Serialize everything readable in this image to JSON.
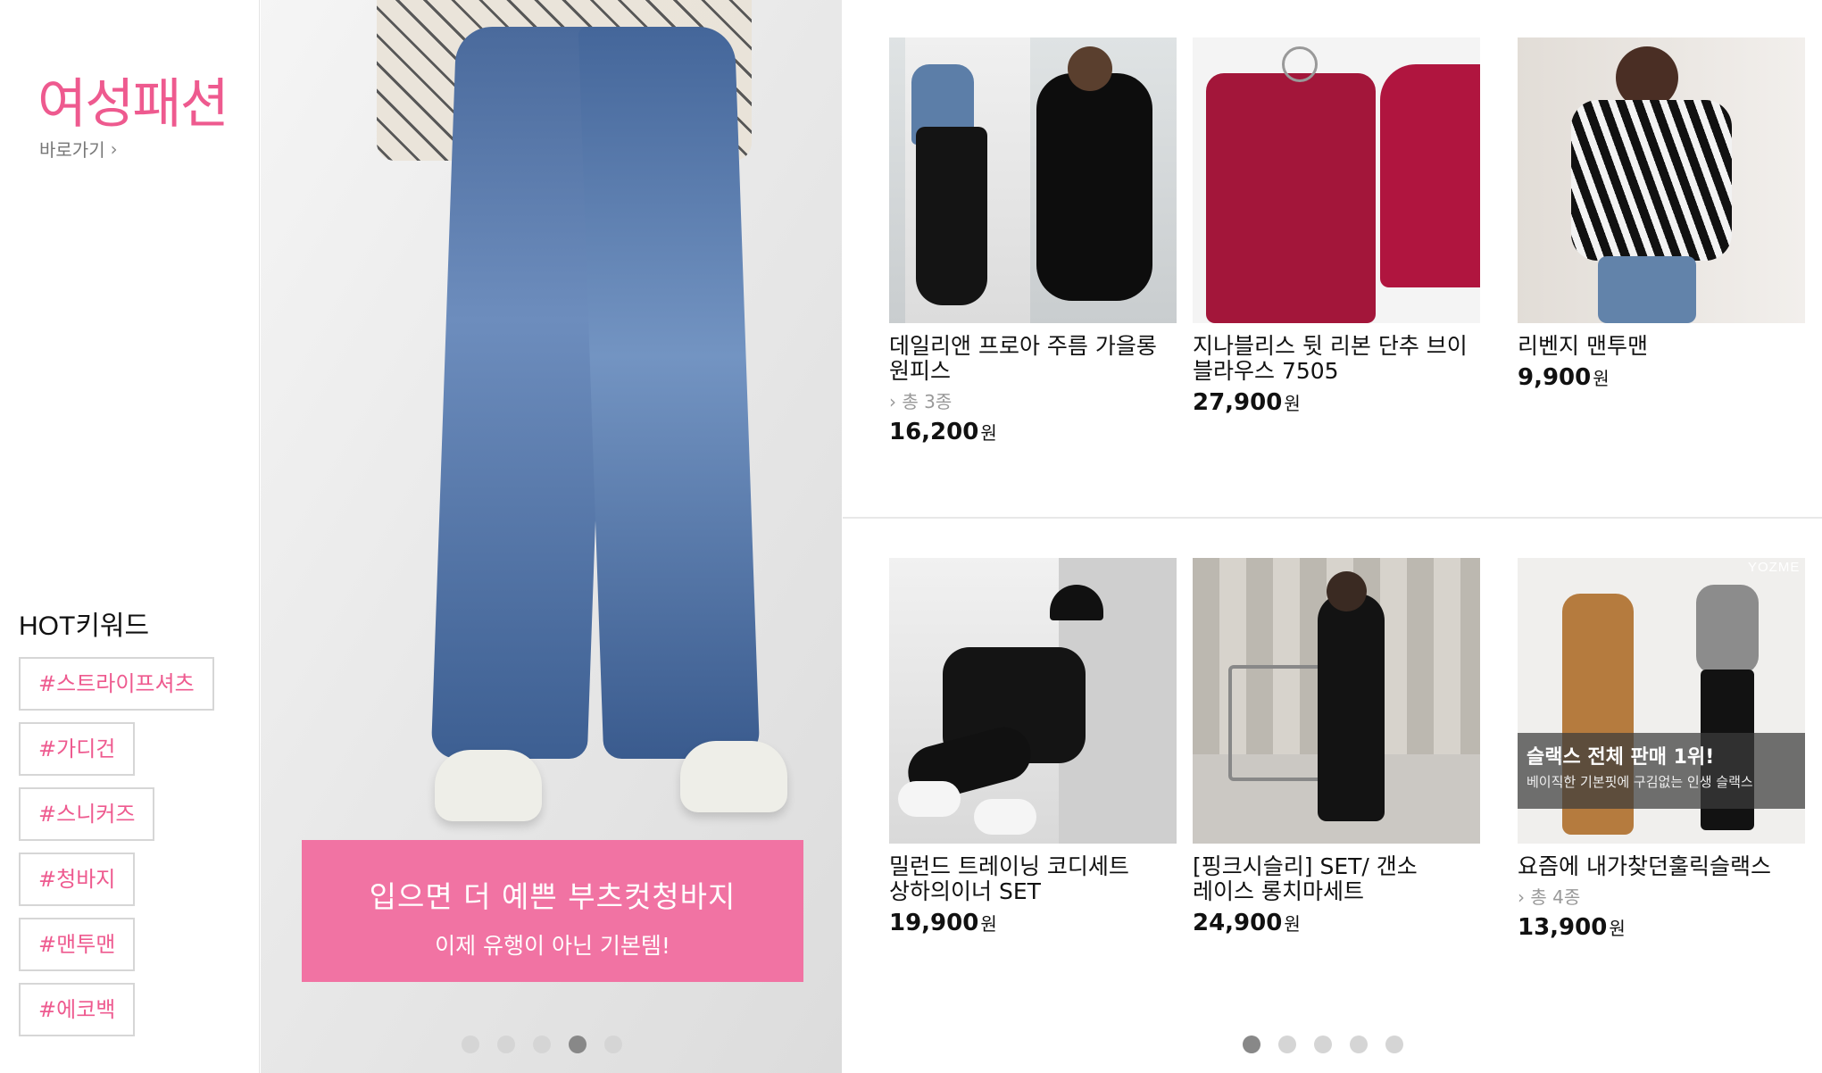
{
  "sidebar": {
    "title": "여성패션",
    "shortcut_label": "바로가기",
    "hot_title": "HOT키워드",
    "tags": [
      "#스트라이프셔츠",
      "#가디건",
      "#스니커즈",
      "#청바지",
      "#맨투맨",
      "#에코백"
    ]
  },
  "hero": {
    "headline": "입으면 더 예쁜 부츠컷청바지",
    "subline": "이제 유행이 아닌 기본템!",
    "slide_index": 4,
    "slide_count": 5
  },
  "products": [
    {
      "name": "데일리앤 프로아 주름 가을롱 원피스",
      "option": "총 3종",
      "price": "16,200",
      "unit": "원"
    },
    {
      "name": "지나블리스 뒷 리본 단추 브이 블라우스 7505",
      "option": "",
      "price": "27,900",
      "unit": "원"
    },
    {
      "name": "리벤지 맨투맨",
      "option": "",
      "price": "9,900",
      "unit": "원"
    },
    {
      "name": "밀런드 트레이닝 코디세트 상하의이너 SET",
      "option": "",
      "price": "19,900",
      "unit": "원"
    },
    {
      "name": "[핑크시슬리] SET/ 갠소 레이스 롱치마세트",
      "option": "",
      "price": "24,900",
      "unit": "원"
    },
    {
      "name": "요즘에 내가찾던훌릭슬랙스",
      "option": "총 4종",
      "price": "13,900",
      "unit": "원"
    }
  ],
  "product6_overlay": {
    "brand": "YOZME",
    "line1": "슬랙스 전체 판매 1위!",
    "line2": "베이직한 기본핏에 구김없는 인생 슬랙스"
  },
  "grid_pager": {
    "active": 1,
    "count": 5
  },
  "colors": {
    "accent": "#ee5a8f",
    "caption_bg": "#f173a3"
  }
}
